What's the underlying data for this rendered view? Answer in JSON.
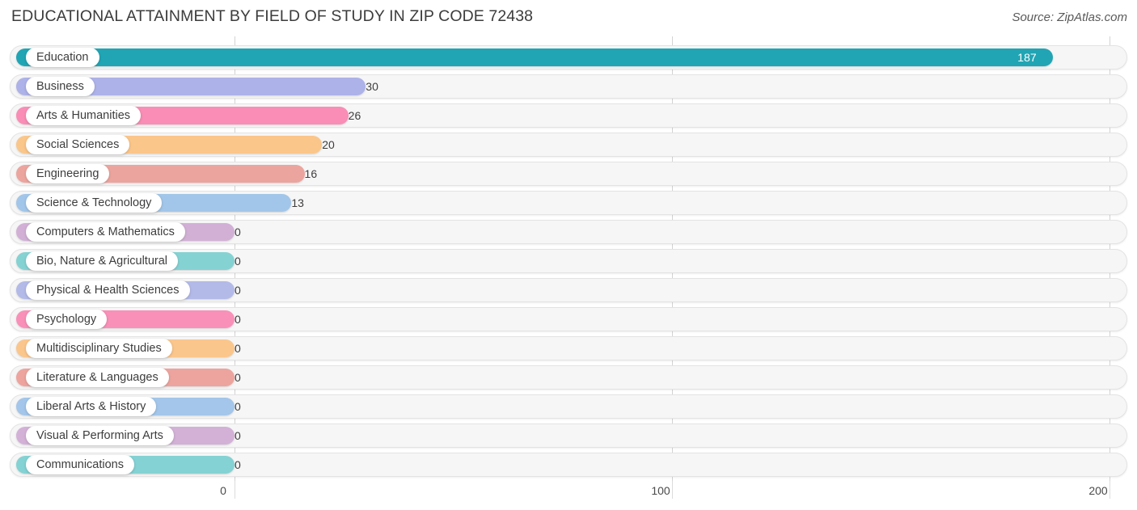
{
  "header": {
    "title": "EDUCATIONAL ATTAINMENT BY FIELD OF STUDY IN ZIP CODE 72438",
    "source": "Source: ZipAtlas.com"
  },
  "chart_data": {
    "type": "bar",
    "orientation": "horizontal",
    "title": "EDUCATIONAL ATTAINMENT BY FIELD OF STUDY IN ZIP CODE 72438",
    "subtitle": "",
    "xlabel": "",
    "ylabel": "",
    "xlim": [
      0,
      200
    ],
    "ticks": [
      "0",
      "100",
      "200"
    ],
    "tick_values": [
      0,
      100,
      200
    ],
    "grid": true,
    "legend": false,
    "categories": [
      "Education",
      "Business",
      "Arts & Humanities",
      "Social Sciences",
      "Engineering",
      "Science & Technology",
      "Computers & Mathematics",
      "Bio, Nature & Agricultural",
      "Physical & Health Sciences",
      "Psychology",
      "Multidisciplinary Studies",
      "Literature & Languages",
      "Liberal Arts & History",
      "Visual & Performing Arts",
      "Communications"
    ],
    "values": [
      187,
      30,
      26,
      20,
      16,
      13,
      0,
      0,
      0,
      0,
      0,
      0,
      0,
      0,
      0
    ],
    "value_labels": [
      "187",
      "30",
      "26",
      "20",
      "16",
      "13",
      "0",
      "0",
      "0",
      "0",
      "0",
      "0",
      "0",
      "0",
      "0"
    ],
    "colors": [
      "#21a5b4",
      "#adb2e8",
      "#f98db5",
      "#fbc68a",
      "#eca49e",
      "#a2c6e9",
      "#d2b0d6",
      "#85d2d3",
      "#b3bae8",
      "#f990b8",
      "#fbc68c",
      "#eda49e",
      "#a3c6ea",
      "#d3b1d7",
      "#84d2d3"
    ]
  },
  "axis": {
    "tick_0": "0",
    "tick_1": "100",
    "tick_2": "200"
  }
}
